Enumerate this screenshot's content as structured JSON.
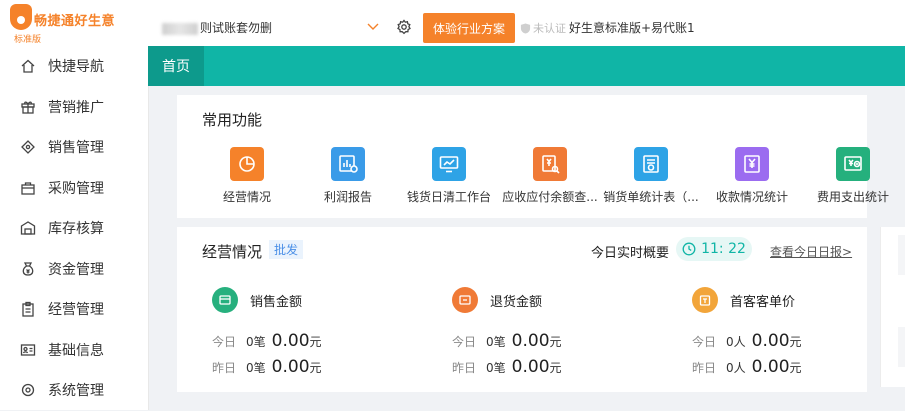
{
  "brand": {
    "name": "畅捷通好生意",
    "edition": "标准版"
  },
  "sidebar": {
    "items": [
      {
        "label": "快捷导航",
        "icon": "home-icon"
      },
      {
        "label": "营销推广",
        "icon": "gift-icon"
      },
      {
        "label": "销售管理",
        "icon": "tag-icon"
      },
      {
        "label": "采购管理",
        "icon": "bag-icon"
      },
      {
        "label": "库存核算",
        "icon": "warehouse-icon"
      },
      {
        "label": "资金管理",
        "icon": "money-bag-icon"
      },
      {
        "label": "经营管理",
        "icon": "clipboard-icon"
      },
      {
        "label": "基础信息",
        "icon": "id-card-icon"
      },
      {
        "label": "系统管理",
        "icon": "system-icon"
      }
    ]
  },
  "topbar": {
    "account": "则试账套勿删",
    "trial_button": "体验行业方案",
    "cert_status": "未认证",
    "edition_text": "好生意标准版+易代账1"
  },
  "tabs": [
    {
      "label": "首页"
    }
  ],
  "common_functions": {
    "title": "常用功能",
    "items": [
      {
        "label": "经营情况",
        "icon": "pie-chart-icon",
        "color": "#f5822a"
      },
      {
        "label": "利润报告",
        "icon": "bar-chart-icon",
        "color": "#3a9be8"
      },
      {
        "label": "钱货日清工作台",
        "icon": "monitor-chart-icon",
        "color": "#2ea3e6"
      },
      {
        "label": "应收应付余额查...",
        "icon": "yen-search-icon",
        "color": "#f07a36"
      },
      {
        "label": "销货单统计表（...",
        "icon": "document-icon",
        "color": "#2ea3e6"
      },
      {
        "label": "收款情况统计",
        "icon": "yen-document-icon",
        "color": "#9b6cf0"
      },
      {
        "label": "费用支出统计",
        "icon": "yen-minus-icon",
        "color": "#25b07d"
      }
    ]
  },
  "business": {
    "title": "经营情况",
    "badge": "批发",
    "realtime_label": "今日实时概要",
    "time": "11: 22",
    "report_link": "查看今日日报>",
    "metrics": [
      {
        "label": "销售金额",
        "icon": "sales-icon",
        "color": "#27b07e",
        "rows": [
          {
            "day": "今日",
            "count": "0笔",
            "amount": "0.00",
            "unit": "元"
          },
          {
            "day": "昨日",
            "count": "0笔",
            "amount": "0.00",
            "unit": "元"
          }
        ]
      },
      {
        "label": "退货金额",
        "icon": "return-icon",
        "color": "#f07a36",
        "rows": [
          {
            "day": "今日",
            "count": "0笔",
            "amount": "0.00",
            "unit": "元"
          },
          {
            "day": "昨日",
            "count": "0笔",
            "amount": "0.00",
            "unit": "元"
          }
        ]
      },
      {
        "label": "首客客单价",
        "icon": "customer-icon",
        "color": "#f2a53a",
        "rows": [
          {
            "day": "今日",
            "count": "0人",
            "amount": "0.00",
            "unit": "元"
          },
          {
            "day": "昨日",
            "count": "0人",
            "amount": "0.00",
            "unit": "元"
          }
        ]
      }
    ]
  }
}
